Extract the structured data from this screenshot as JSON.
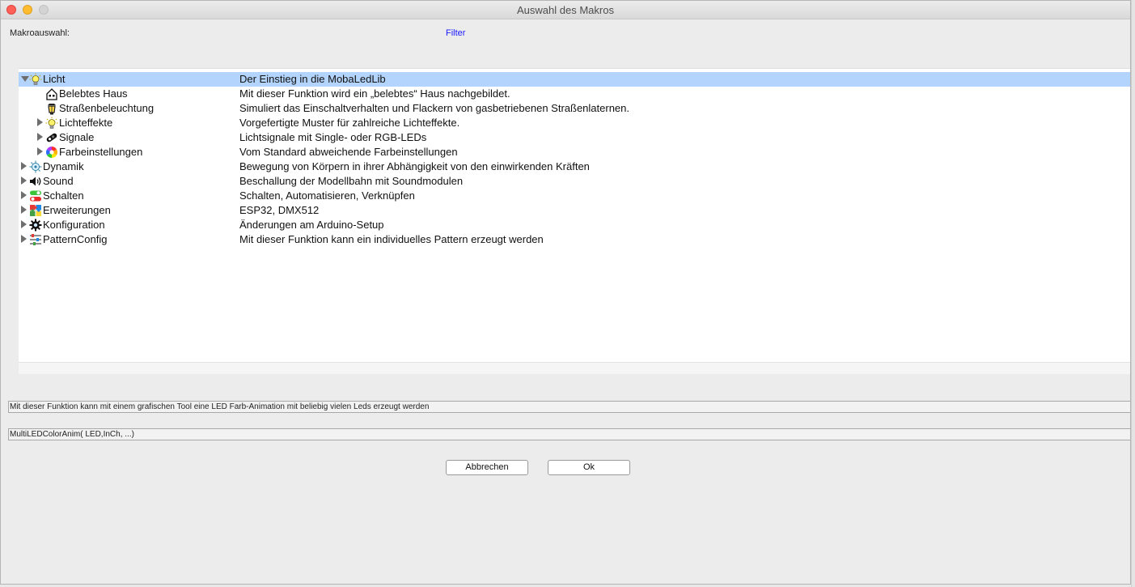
{
  "window": {
    "title": "Auswahl des Makros"
  },
  "labels": {
    "makroauswahl": "Makroauswahl:",
    "filter": "Filter"
  },
  "tree": {
    "rows": [
      {
        "label": "Licht",
        "desc": "Der Einstieg in die MobaLedLib",
        "level": 0,
        "expanded": true,
        "icon": "bulb-icon",
        "selected": true
      },
      {
        "label": "Belebtes Haus",
        "desc": "Mit dieser Funktion wird ein „belebtes“ Haus nachgebildet.",
        "level": 1,
        "expanded": null,
        "icon": "house-icon"
      },
      {
        "label": "Straßenbeleuchtung",
        "desc": "Simuliert das Einschaltverhalten und Flackern von gasbetriebenen Straßenlaternen.",
        "level": 1,
        "expanded": null,
        "icon": "lantern-icon"
      },
      {
        "label": "Lichteffekte",
        "desc": "Vorgefertigte Muster für zahlreiche Lichteffekte.",
        "level": 1,
        "expanded": false,
        "icon": "bulb-icon"
      },
      {
        "label": "Signale",
        "desc": "Lichtsignale mit Single- oder RGB-LEDs",
        "level": 1,
        "expanded": false,
        "icon": "signal-icon"
      },
      {
        "label": "Farbeinstellungen",
        "desc": "Vom Standard abweichende Farbeinstellungen",
        "level": 1,
        "expanded": false,
        "icon": "color-wheel-icon"
      },
      {
        "label": "Dynamik",
        "desc": "Bewegung von Körpern in ihrer Abhängigkeit von den einwirkenden Kräften",
        "level": 0,
        "expanded": false,
        "icon": "dynamics-icon"
      },
      {
        "label": "Sound",
        "desc": "Beschallung der Modellbahn mit Soundmodulen",
        "level": 0,
        "expanded": false,
        "icon": "speaker-icon"
      },
      {
        "label": "Schalten",
        "desc": "Schalten, Automatisieren, Verknüpfen",
        "level": 0,
        "expanded": false,
        "icon": "switch-icon"
      },
      {
        "label": "Erweiterungen",
        "desc": "ESP32, DMX512",
        "level": 0,
        "expanded": false,
        "icon": "puzzle-icon"
      },
      {
        "label": "Konfiguration",
        "desc": "Änderungen am Arduino-Setup",
        "level": 0,
        "expanded": false,
        "icon": "gear-icon"
      },
      {
        "label": "PatternConfig",
        "desc": "Mit dieser Funktion kann ein individuelles Pattern erzeugt werden",
        "level": 0,
        "expanded": false,
        "icon": "sliders-icon"
      }
    ]
  },
  "description_box": "Mit dieser Funktion kann mit einem grafischen Tool eine LED Farb-Animation mit beliebig vielen Leds erzeugt werden",
  "macro_box": "MultiLEDColorAnim( LED,InCh, ...)",
  "buttons": {
    "cancel": "Abbrechen",
    "ok": "Ok"
  },
  "colors": {
    "selection": "#b3d4fc",
    "filter_link": "#1a1aff"
  }
}
